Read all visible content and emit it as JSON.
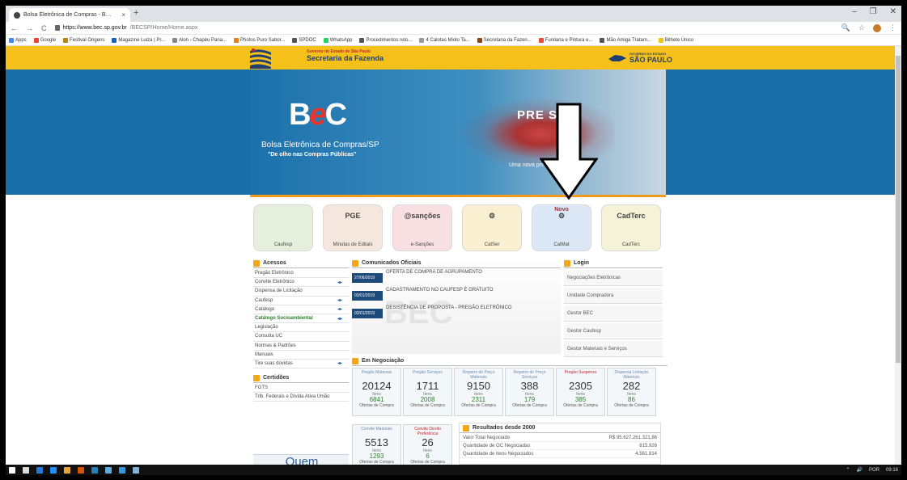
{
  "browser": {
    "tab_title": "Bolsa Eletrônica de Compras - B…",
    "tab_close": "×",
    "new_tab": "+",
    "window_controls": [
      "–",
      "❐",
      "✕"
    ],
    "url_host": "https://www.bec.sp.gov.br",
    "url_path": "/BECSP/Home/Home.aspx",
    "nav": [
      "←",
      "→",
      "C"
    ],
    "addr_right": [
      "🔍",
      "☆",
      "⋮"
    ]
  },
  "bookmarks": [
    {
      "label": "Apps",
      "color": "#4285f4"
    },
    {
      "label": "Google",
      "color": "#ea4335"
    },
    {
      "label": "Festival Origens",
      "color": "#b8860b"
    },
    {
      "label": "Magazine Luiza | Pr...",
      "color": "#1565c0"
    },
    {
      "label": "Alon - Chapéu Pana...",
      "color": "#888888"
    },
    {
      "label": "Photos Puro Sabor...",
      "color": "#e67e22"
    },
    {
      "label": "SPDOC",
      "color": "#555555"
    },
    {
      "label": "WhatsApp",
      "color": "#25d366"
    },
    {
      "label": "Procedimentos reto...",
      "color": "#555555"
    },
    {
      "label": "4 Calotas Miolo Ta...",
      "color": "#999999"
    },
    {
      "label": "Secretaria da Fazen...",
      "color": "#8b4513"
    },
    {
      "label": "Funilaria e Pintura e...",
      "color": "#e74c3c"
    },
    {
      "label": "Mão Amiga Tratam...",
      "color": "#555555"
    },
    {
      "label": "Bilhete Único",
      "color": "#f1c40f"
    }
  ],
  "header": {
    "gov_small": "Governo do Estado de São Paulo",
    "secretaria": "Secretaria da Fazenda",
    "sp_small": "GOVERNO DO ESTADO",
    "sp_big": "SÃO PAULO"
  },
  "banner": {
    "logo_b": "B",
    "logo_e": "e",
    "logo_c": "C",
    "title": "Bolsa Eletrônica de Compras/SP",
    "slogan": "\"De olho nas Compras Públicas\"",
    "pregao": "PRE SP",
    "tagline": "Uma nova                  preços"
  },
  "tiles": [
    {
      "label": "Caufesp",
      "icon": ""
    },
    {
      "label": "Minutas de Editais",
      "icon": "PGE"
    },
    {
      "label": "e-Sanções",
      "icon": "@sanções"
    },
    {
      "label": "CatSer",
      "icon": "⚙"
    },
    {
      "label": "CatMat",
      "icon": "⚙",
      "badge": "Novo"
    },
    {
      "label": "CadTerc",
      "icon": "CadTerc"
    }
  ],
  "acessos": {
    "title": "Acessos",
    "items": [
      {
        "label": "Pregão Eletrônico",
        "arrow": ""
      },
      {
        "label": "Convite Eletrônico",
        "arrow": "◂▸"
      },
      {
        "label": "Dispensa de Licitação",
        "arrow": ""
      },
      {
        "label": "Caufesp",
        "arrow": "◂▸"
      },
      {
        "label": "Catálogo",
        "arrow": "◂▸"
      },
      {
        "label": "Catálogo Socioambiental",
        "arrow": "◂▸"
      },
      {
        "label": "Legislação",
        "arrow": ""
      },
      {
        "label": "Consulta UC",
        "arrow": ""
      },
      {
        "label": "Normas & Padrões",
        "arrow": ""
      },
      {
        "label": "Manuais",
        "arrow": ""
      },
      {
        "label": "Tire suas dúvidas",
        "arrow": "◂▸"
      }
    ]
  },
  "certidoes": {
    "title": "Certidões",
    "items": [
      "FGTS",
      "Trib. Federais e Dívida Ativa União"
    ]
  },
  "quem_somos": "Quem Somos",
  "comunicados": {
    "title": "Comunicados Oficiais",
    "items": [
      {
        "date": "27/06/2019",
        "text": "OFERTA DE COMPRA DE AGRUPAMENTO"
      },
      {
        "date": "03/01/2019",
        "text": "CADASTRAMENTO NO CAUFESP É GRATUITO"
      },
      {
        "date": "03/01/2019",
        "text": "DESISTÊNCIA DE PROPOSTA - PREGÃO ELETRÔNICO"
      }
    ]
  },
  "login": {
    "title": "Login",
    "items": [
      "Negociações Eletrônicas",
      "Unidade Compradora",
      "Gestor BEC",
      "Gestor Caufesp",
      "Gestor Materiais e Serviços"
    ]
  },
  "negociacao": {
    "title": "Em Negociação",
    "row1": [
      {
        "label": "Pregão Materiais",
        "num": "20124",
        "itens": "Itens",
        "ofertas": "6841",
        "oflbl": "Ofertas de Compra",
        "red": false
      },
      {
        "label": "Pregão Serviços",
        "num": "1711",
        "itens": "Itens",
        "ofertas": "2008",
        "oflbl": "Ofertas de Compra",
        "red": false
      },
      {
        "label": "Registro de Preço Materiais",
        "num": "9150",
        "itens": "Itens",
        "ofertas": "2311",
        "oflbl": "Ofertas de Compra",
        "red": false
      },
      {
        "label": "Registro de Preço Serviços",
        "num": "388",
        "itens": "Itens",
        "ofertas": "179",
        "oflbl": "Ofertas de Compra",
        "red": false
      },
      {
        "label": "Pregão Suspenso",
        "num": "2305",
        "itens": "Itens",
        "ofertas": "385",
        "oflbl": "Ofertas de Compra",
        "red": true
      },
      {
        "label": "Dispensa Licitação Materiais",
        "num": "282",
        "itens": "Itens",
        "ofertas": "86",
        "oflbl": "Ofertas de Compra",
        "red": false
      }
    ],
    "row2": [
      {
        "label": "Convite Materiais",
        "num": "5513",
        "itens": "Itens",
        "ofertas": "1293",
        "oflbl": "Ofertas de Compra",
        "red": false
      },
      {
        "label": "Convite Direito Preferência",
        "num": "26",
        "itens": "Itens",
        "ofertas": "6",
        "oflbl": "Ofertas de Compra",
        "red": true
      }
    ]
  },
  "resultados": {
    "title": "Resultados desde 2000",
    "rows": [
      {
        "label": "Valor Total Negociado",
        "value": "R$ 95.627.261.321,86"
      },
      {
        "label": "Quantidade de OC Negociadas",
        "value": "815.926"
      },
      {
        "label": "Quantidade de Itens Negociados",
        "value": "4.561.814"
      }
    ]
  },
  "taskbar": {
    "tray": [
      "⌃",
      "🔊",
      "POR",
      "09:16"
    ],
    "colors": [
      "#ffffff",
      "#dddddd",
      "#2a78d6",
      "#1e90ff",
      "#e8a33d",
      "#d35400",
      "#2980b9",
      "#5dade2",
      "#3498db",
      "#7fb3d5"
    ]
  }
}
